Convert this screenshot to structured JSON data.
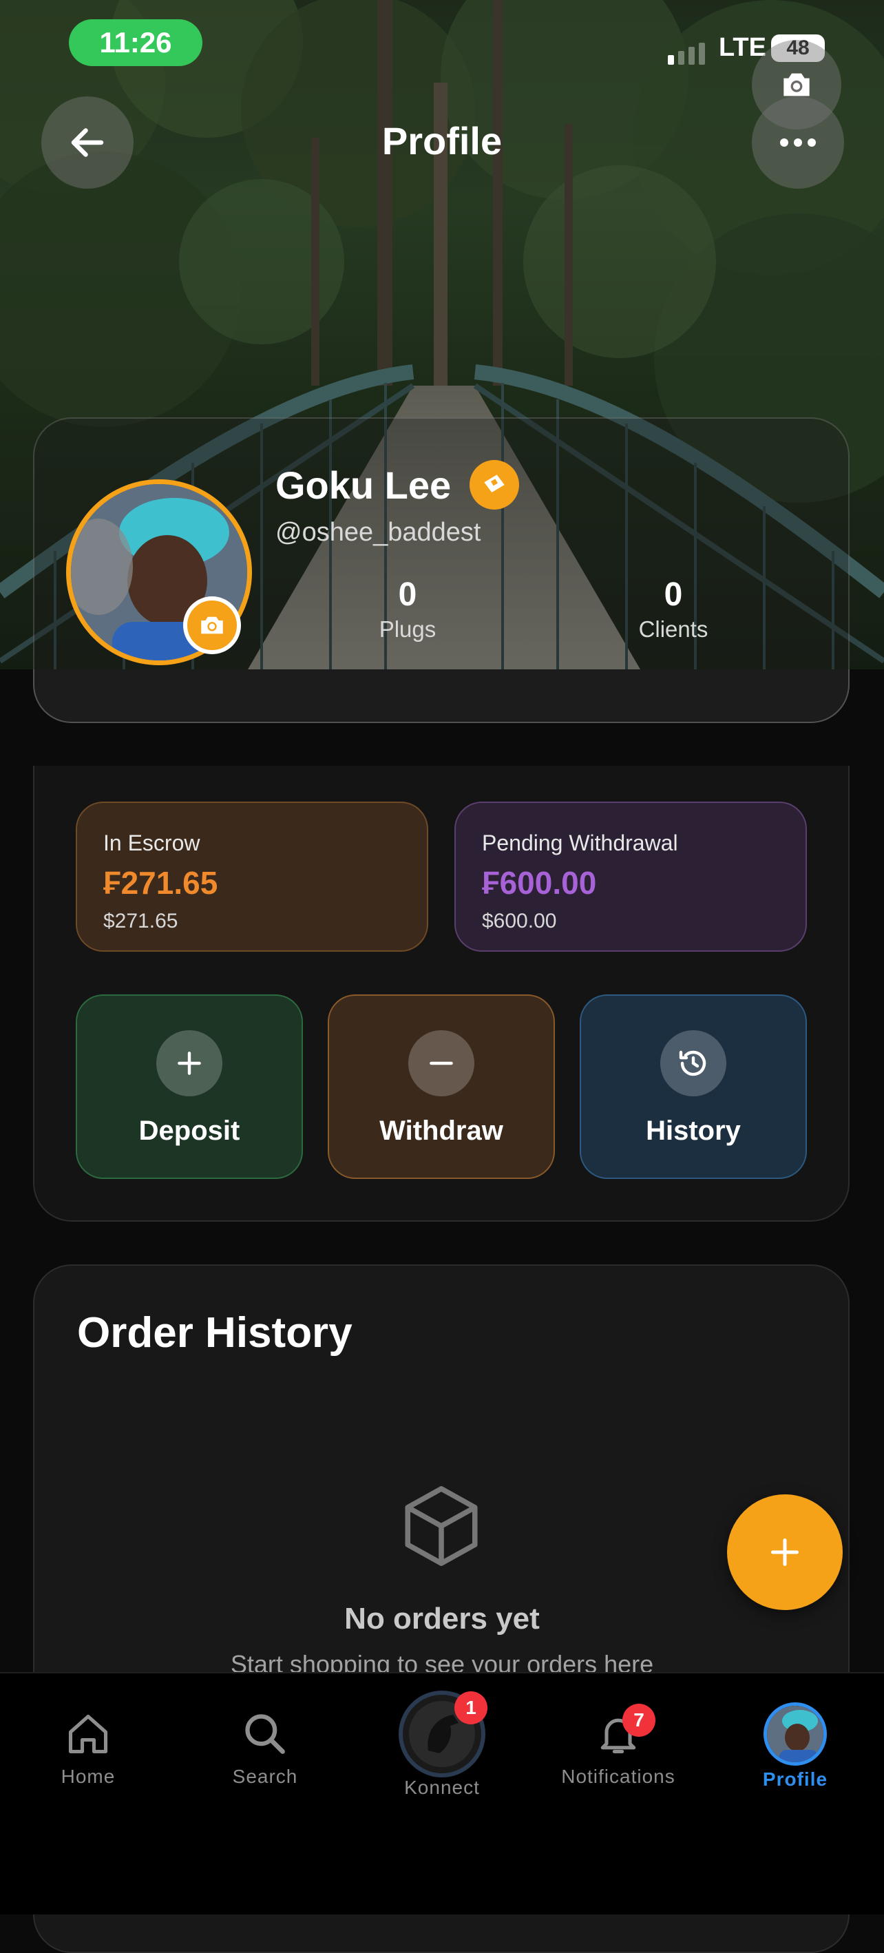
{
  "status_bar": {
    "time": "11:26",
    "network": "LTE",
    "battery": "48"
  },
  "header": {
    "title": "Profile"
  },
  "profile": {
    "name": "Goku Lee",
    "handle": "@oshee_baddest",
    "stats": [
      {
        "value": "0",
        "label": "Plugs"
      },
      {
        "value": "0",
        "label": "Clients"
      }
    ]
  },
  "balances": {
    "escrow": {
      "title": "In Escrow",
      "amount": "₣271.65",
      "usd": "$271.65"
    },
    "pending": {
      "title": "Pending Withdrawal",
      "amount": "₣600.00",
      "usd": "$600.00"
    }
  },
  "actions": {
    "deposit": "Deposit",
    "withdraw": "Withdraw",
    "history": "History"
  },
  "orders": {
    "title": "Order History",
    "empty_title": "No orders yet",
    "empty_subtitle": "Start shopping to see your orders here"
  },
  "tabbar": {
    "home": "Home",
    "search": "Search",
    "konnect": "Konnect",
    "konnect_badge": "1",
    "notifications": "Notifications",
    "notifications_badge": "7",
    "profile": "Profile"
  },
  "colors": {
    "accent_orange": "#f5a218",
    "escrow_amount": "#f08a2c",
    "pending_amount": "#a662d6",
    "active_tab": "#2f8ff0",
    "badge_red": "#f2323a"
  },
  "icons": [
    "back-arrow-icon",
    "camera-icon",
    "more-icon",
    "verified-icon",
    "plus-icon",
    "minus-icon",
    "history-icon",
    "box-icon",
    "home-icon",
    "search-icon",
    "bell-icon"
  ]
}
